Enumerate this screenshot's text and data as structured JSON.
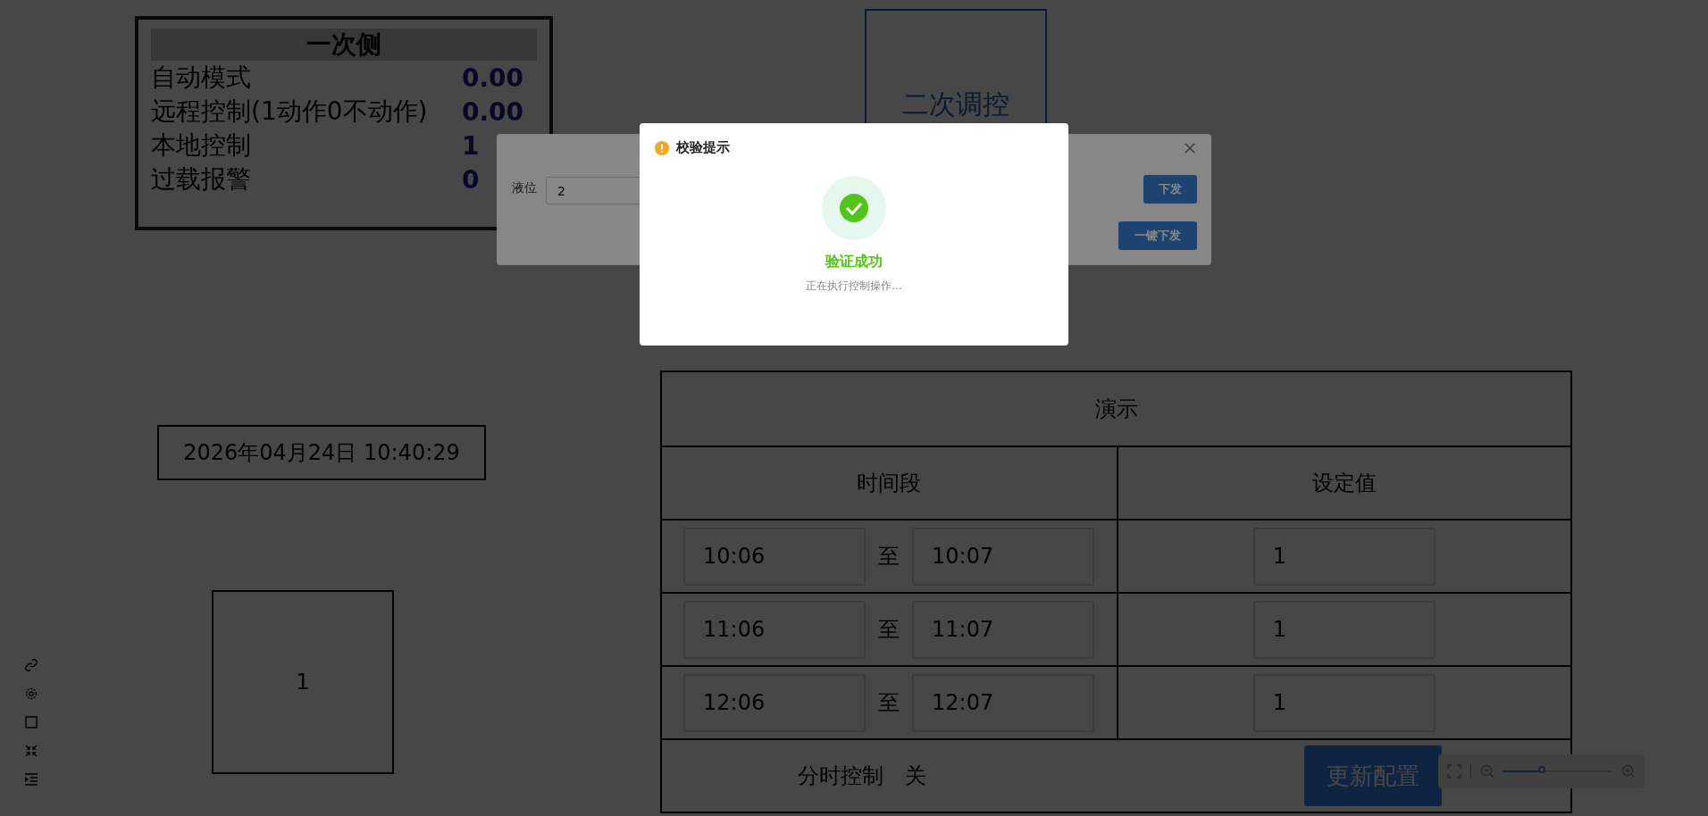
{
  "primary_panel": {
    "title": "一次侧",
    "rows": [
      {
        "label": "自动模式",
        "value": "0.00"
      },
      {
        "label": "远程控制(1动作0不动作)",
        "value": "0.00"
      },
      {
        "label": "本地控制",
        "value": "1"
      },
      {
        "label": "过载报警",
        "value": "0"
      }
    ]
  },
  "secondary_box": {
    "label": "二次调控"
  },
  "datetime": "2026年04月24日 10:40:29",
  "value_box": "1",
  "table": {
    "title": "演示",
    "columns": [
      "时间段",
      "设定值"
    ],
    "rows": [
      {
        "start": "10:06",
        "separator": "至",
        "end": "10:07",
        "setpoint": "1"
      },
      {
        "start": "11:06",
        "separator": "至",
        "end": "11:07",
        "setpoint": "1"
      },
      {
        "start": "12:06",
        "separator": "至",
        "end": "12:07",
        "setpoint": "1"
      }
    ],
    "footer": {
      "label": "分时控制",
      "state": "关",
      "button": "更新配置"
    }
  },
  "zoom_control": {
    "level": 0.37
  },
  "back_dialog": {
    "field_label": "液位",
    "field_value": "2",
    "buttons": [
      "下发",
      "一键下发"
    ]
  },
  "dialog": {
    "title": "校验提示",
    "status": "验证成功",
    "message": "正在执行控制操作..."
  }
}
